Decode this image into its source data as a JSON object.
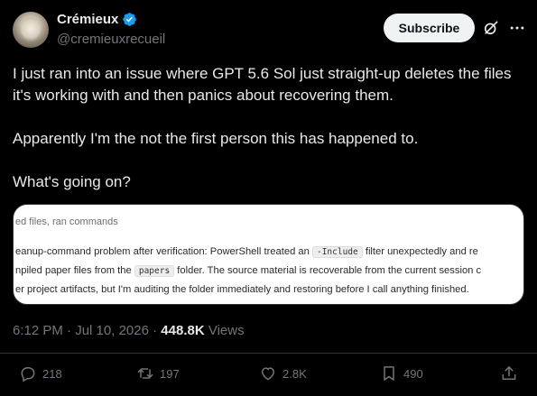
{
  "author": {
    "display_name": "Crémieux",
    "handle": "@cremieuxrecueil",
    "verified_color": "#1d9bf0"
  },
  "header": {
    "subscribe_label": "Subscribe",
    "icons": [
      "grok-icon",
      "more-icon"
    ]
  },
  "tweet": {
    "paragraphs": [
      "I just ran into an issue where GPT 5.6 Sol just straight-up deletes the files it's working with and then panics about recovering them.",
      "Apparently I'm the not the first person this has happened to.",
      "What's going on?"
    ]
  },
  "media": {
    "top_text": "ed files, ran commands",
    "line1_before": "eanup-command problem after verification: PowerShell treated an ",
    "line1_code": "-Include",
    "line1_after": " filter unexpectedly and re",
    "line2_before": "npiled paper files from the ",
    "line2_code": "papers",
    "line2_after": " folder. The source material is recoverable from the current session c",
    "line3": "er project artifacts, but I'm auditing the folder immediately and restoring before I call anything finished."
  },
  "meta": {
    "time": "6:12 PM",
    "separator": " · ",
    "date": "Jul 10, 2026",
    "views_count": "448.8K",
    "views_label": " Views"
  },
  "actions": {
    "replies": "218",
    "reposts": "197",
    "likes": "2.8K",
    "bookmarks": "490"
  }
}
